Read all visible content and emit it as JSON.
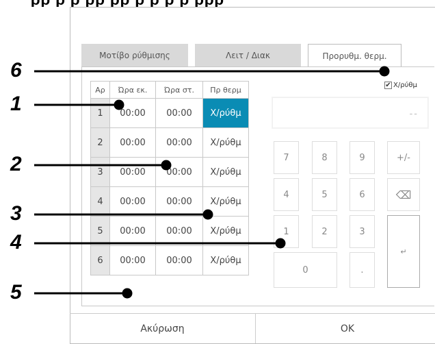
{
  "header_fragment": "ρρ ρ ρ ρρ ρρ ρ ρ ρ ρ ρρρ",
  "tabs": [
    {
      "label": "Μοτίβο ρύθμισης",
      "active": false
    },
    {
      "label": "Λειτ / Διακ",
      "active": false
    },
    {
      "label": "Προρυθμ. θερμ.",
      "active": true
    }
  ],
  "table": {
    "headers": [
      "Αρ",
      "Ώρα εκ.",
      "Ώρα στ.",
      "Πρ θερμ"
    ],
    "rows": [
      {
        "no": "1",
        "start": "00:00",
        "stop": "00:00",
        "preset": "Χ/ρύθμ",
        "selected": true
      },
      {
        "no": "2",
        "start": "00:00",
        "stop": "00:00",
        "preset": "Χ/ρύθμ",
        "selected": false
      },
      {
        "no": "3",
        "start": "00:00",
        "stop": "00:00",
        "preset": "Χ/ρύθμ",
        "selected": false
      },
      {
        "no": "4",
        "start": "00:00",
        "stop": "00:00",
        "preset": "Χ/ρύθμ",
        "selected": false
      },
      {
        "no": "5",
        "start": "00:00",
        "stop": "00:00",
        "preset": "Χ/ρύθμ",
        "selected": false
      },
      {
        "no": "6",
        "start": "00:00",
        "stop": "00:00",
        "preset": "Χ/ρύθμ",
        "selected": false
      }
    ]
  },
  "manual_checkbox": {
    "label": "Χ/ρύθμ",
    "checked": true,
    "mark": "✔"
  },
  "display_value": "--",
  "keypad": {
    "k7": "7",
    "k8": "8",
    "k9": "9",
    "plusminus": "+/-",
    "k4": "4",
    "k5": "5",
    "k6": "6",
    "backspace_icon": "⌫",
    "k1": "1",
    "k2": "2",
    "k3": "3",
    "enter_icon": "↵",
    "k0": "0",
    "dot": "."
  },
  "footer": {
    "cancel": "Ακύρωση",
    "ok": "OK"
  },
  "callouts": [
    "6",
    "1",
    "2",
    "3",
    "4",
    "5"
  ],
  "colors": {
    "highlight": "#0a8cb4",
    "callout_line": "#000000"
  }
}
